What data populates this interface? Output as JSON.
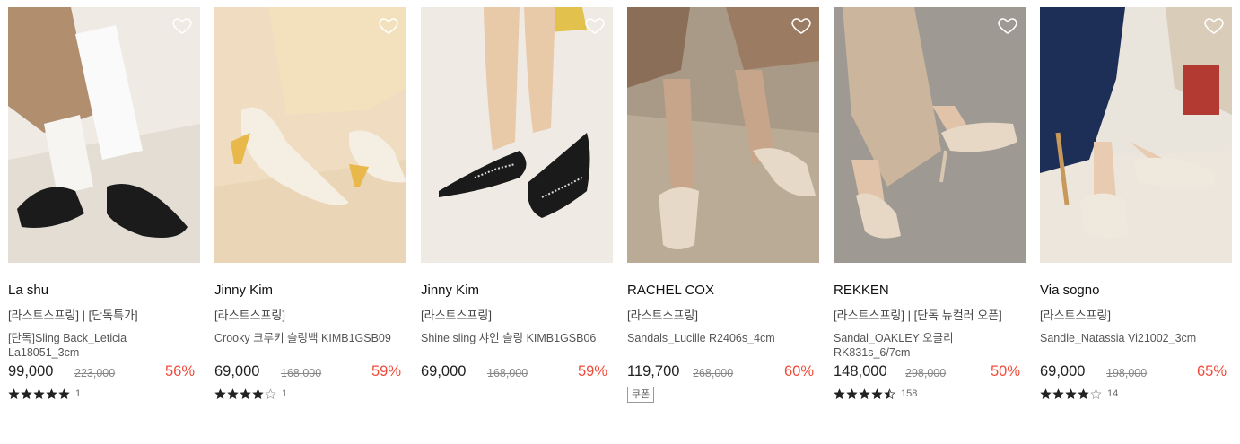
{
  "products": [
    {
      "brand": "La shu",
      "tags": "[라스트스프링] | [단독특가]",
      "name": "[단독]Sling Back_Leticia La18051_3cm",
      "price": "99,000",
      "original_price": "223,000",
      "discount": "56%",
      "rating": 5,
      "reviews": "1",
      "photo_colors": {
        "bg": "#efeae3",
        "floor": "#e4ddd3",
        "shoe": "#1b1b1b",
        "accent": "#f7f5f1"
      }
    },
    {
      "brand": "Jinny Kim",
      "tags": "[라스트스프링]",
      "name": "Crooky 크루키 슬링백 KIMB1GSB09",
      "price": "69,000",
      "original_price": "168,000",
      "discount": "59%",
      "rating": 4,
      "reviews": "1",
      "photo_colors": {
        "bg": "#f0dcc0",
        "floor": "#ead5b6",
        "shoe": "#f4efe2",
        "accent": "#e8b84a"
      }
    },
    {
      "brand": "Jinny Kim",
      "tags": "[라스트스프링]",
      "name": "Shine sling 샤인 슬링 KIMB1GSB06",
      "price": "69,000",
      "original_price": "168,000",
      "discount": "59%",
      "rating": null,
      "reviews": "",
      "photo_colors": {
        "bg": "#f0eae4",
        "floor": "#ebe3da",
        "shoe": "#1a1a1a",
        "accent": "#e8c9a8"
      }
    },
    {
      "brand": "RACHEL COX",
      "tags": "[라스트스프링]",
      "name": "Sandals_Lucille R2406s_4cm",
      "price": "119,700",
      "original_price": "268,000",
      "discount": "60%",
      "rating": null,
      "reviews": "",
      "coupon": "쿠폰",
      "photo_colors": {
        "bg": "#a89a86",
        "floor": "#b9ab95",
        "shoe": "#e7d9c7",
        "accent": "#8a6e58"
      }
    },
    {
      "brand": "REKKEN",
      "tags": "[라스트스프링] | [단독 뉴컬러 오픈]",
      "name": "Sandal_OAKLEY 오클리 RK831s_6/7cm",
      "price": "148,000",
      "original_price": "298,000",
      "discount": "50%",
      "rating": 4.5,
      "reviews": "158",
      "photo_colors": {
        "bg": "#9e9a93",
        "floor": "#a8a49d",
        "shoe": "#e6d8c4",
        "accent": "#cbb59d"
      }
    },
    {
      "brand": "Via sogno",
      "tags": "[라스트스프링]",
      "name": "Sandle_Natassia Vi21002_3cm",
      "price": "69,000",
      "original_price": "198,000",
      "discount": "65%",
      "rating": 4,
      "reviews": "14",
      "photo_colors": {
        "bg": "#e9e4dc",
        "floor": "#ece6dc",
        "shoe": "#efe9dd",
        "accent": "#1d2f57"
      }
    }
  ]
}
